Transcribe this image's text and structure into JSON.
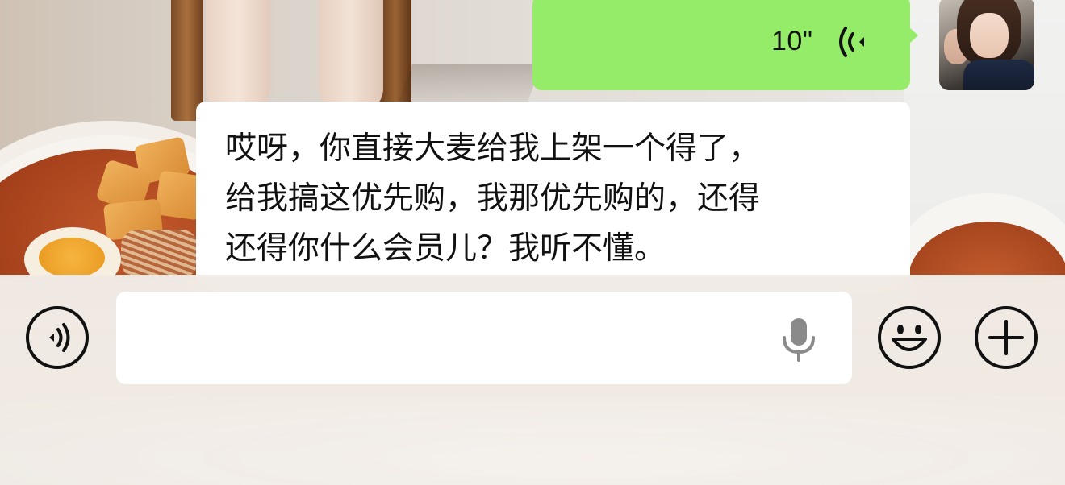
{
  "conversation": {
    "outgoing_voice_message": {
      "duration": "10\"",
      "icon": "voice-wave-icon",
      "bubble_color": "#95ec69"
    },
    "contact_avatar": {
      "icon": "avatar-photo"
    },
    "incoming_message": {
      "text": "哎呀，你直接大麦给我上架一个得了，\n给我搞这优先购，我那优先购的，还得\n还得你什么会员儿？我听不懂。",
      "bubble_color": "#ffffff"
    }
  },
  "input_bar": {
    "voice_toggle_icon": "voice-mode-icon",
    "message_input": {
      "value": "",
      "placeholder": ""
    },
    "mic_icon": "microphone-icon",
    "emoji_icon": "emoji-smile-icon",
    "plus_icon": "plus-circle-icon"
  }
}
